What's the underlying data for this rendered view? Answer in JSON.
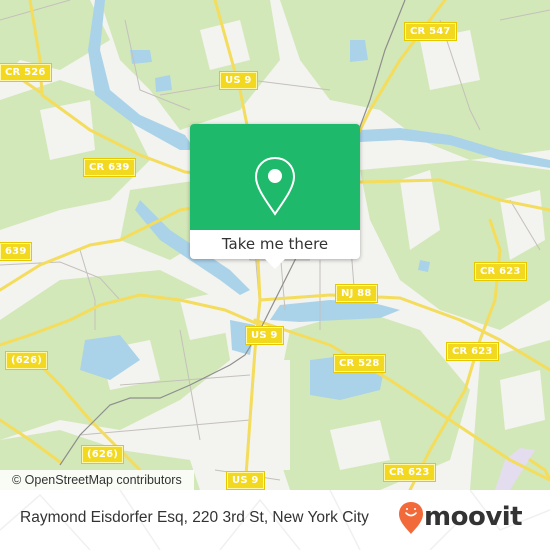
{
  "map": {
    "attribution": "© OpenStreetMap contributors",
    "road_labels": [
      {
        "id": "cr526",
        "text": "CR 526"
      },
      {
        "id": "us9-north",
        "text": "US 9"
      },
      {
        "id": "cr547",
        "text": "CR 547"
      },
      {
        "id": "cr639-a",
        "text": "CR 639"
      },
      {
        "id": "cr639-b",
        "text": "639"
      },
      {
        "id": "cr623-a",
        "text": "CR 623"
      },
      {
        "id": "nj88",
        "text": "NJ 88"
      },
      {
        "id": "us9-center",
        "text": "US 9"
      },
      {
        "id": "cr528",
        "text": "CR 528"
      },
      {
        "id": "cr623-b",
        "text": "CR 623"
      },
      {
        "id": "cr626-a",
        "text": "(626)"
      },
      {
        "id": "cr626-b",
        "text": "(626)"
      },
      {
        "id": "us9-south",
        "text": "US 9"
      },
      {
        "id": "cr623-c",
        "text": "CR 623"
      }
    ],
    "colors": {
      "land": "#f3f3ef",
      "forest": "#cfe6b0",
      "water": "#aad3ea",
      "road": "#f4dc5c",
      "minor_road": "#c8c4c0",
      "rail": "#8a8a8a"
    }
  },
  "popup": {
    "icon": "map-pin-icon",
    "action_label": "Take me there",
    "color": "#1fb96b"
  },
  "footer": {
    "address": "Raymond Eisdorfer Esq, 220 3rd St, New York City",
    "brand": "moovit",
    "brand_color": "#f26a3a"
  }
}
